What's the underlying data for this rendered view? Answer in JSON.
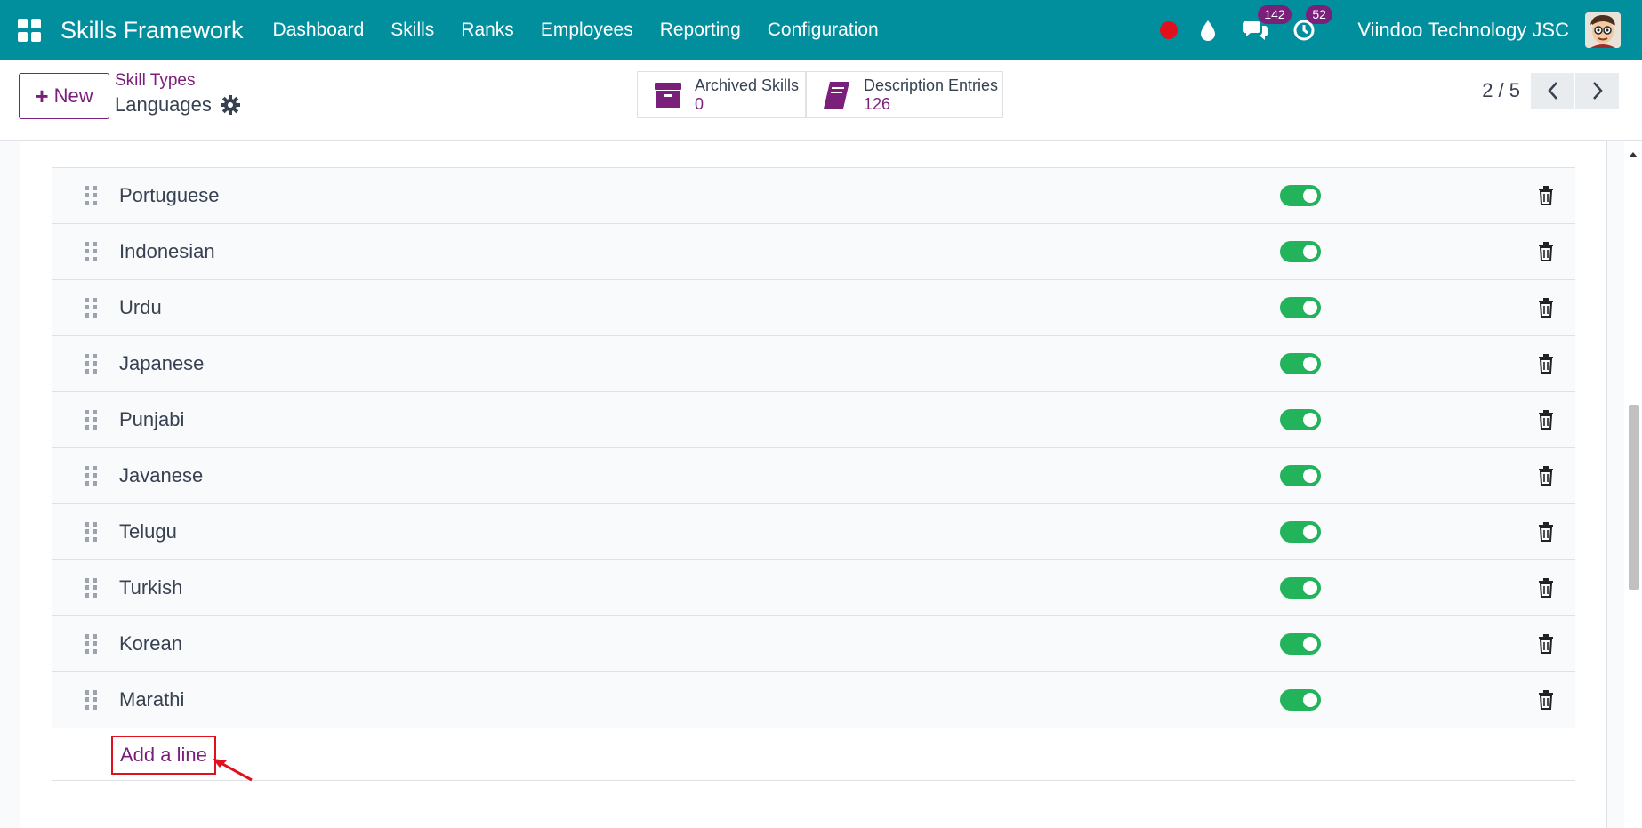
{
  "navbar": {
    "brand": "Skills Framework",
    "menu": [
      {
        "label": "Dashboard"
      },
      {
        "label": "Skills"
      },
      {
        "label": "Ranks"
      },
      {
        "label": "Employees"
      },
      {
        "label": "Reporting"
      },
      {
        "label": "Configuration"
      }
    ],
    "messages_count": "142",
    "activities_count": "52",
    "company": "Viindoo Technology JSC",
    "accent_color": "#018f9e"
  },
  "control": {
    "new_label": "New",
    "breadcrumb": "Skill Types",
    "record_title": "Languages",
    "stats": [
      {
        "icon": "archive-icon",
        "label": "Archived Skills",
        "value": "0"
      },
      {
        "icon": "book-icon",
        "label": "Description Entries",
        "value": "126"
      }
    ],
    "pager": "2 / 5"
  },
  "skills": [
    {
      "name": "Portuguese",
      "active": true
    },
    {
      "name": "Indonesian",
      "active": true
    },
    {
      "name": "Urdu",
      "active": true
    },
    {
      "name": "Japanese",
      "active": true
    },
    {
      "name": "Punjabi",
      "active": true
    },
    {
      "name": "Javanese",
      "active": true
    },
    {
      "name": "Telugu",
      "active": true
    },
    {
      "name": "Turkish",
      "active": true
    },
    {
      "name": "Korean",
      "active": true
    },
    {
      "name": "Marathi",
      "active": true
    }
  ],
  "add_line_label": "Add a line",
  "colors": {
    "primary": "#7a1f7a",
    "toggle_on": "#22b35b",
    "highlight": "#e0101d"
  }
}
